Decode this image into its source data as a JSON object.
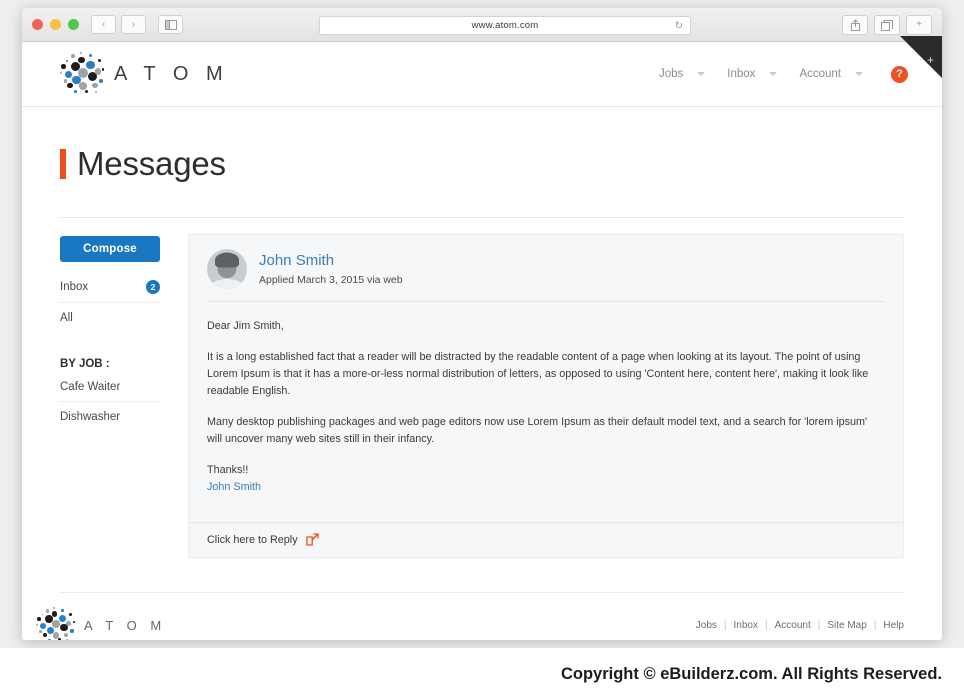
{
  "browser": {
    "url": "www.atom.com",
    "traffic_lights": [
      "close",
      "minimize",
      "maximize"
    ],
    "back_label": "‹",
    "forward_label": "›",
    "sidebar_icon": "sidebar-icon",
    "reload_icon": "reload-icon",
    "share_icon": "share-icon",
    "tabs_icon": "tabs-icon",
    "new_tab_label": "+",
    "corner_plus_label": "+"
  },
  "header": {
    "brand": "A T O M",
    "nav": [
      {
        "label": "Jobs",
        "has_caret": true
      },
      {
        "label": "Inbox",
        "has_caret": true
      },
      {
        "label": "Account",
        "has_caret": true
      }
    ],
    "help_label": "?",
    "help_color": "#ef5022"
  },
  "page": {
    "title": "Messages",
    "accent_color": "#ef5022"
  },
  "sidebar": {
    "compose_label": "Compose",
    "compose_color": "#1a78c2",
    "links": [
      {
        "label": "Inbox",
        "badge": "2"
      },
      {
        "label": "All",
        "badge": ""
      }
    ],
    "by_job_heading": "BY JOB :",
    "jobs": [
      {
        "label": "Cafe Waiter"
      },
      {
        "label": "Dishwasher"
      }
    ]
  },
  "message": {
    "sender": "John Smith",
    "meta": "Applied March 3,  2015 via web",
    "avatar": "user-avatar",
    "greeting": "Dear Jim Smith,",
    "paragraph1": "It is a long established fact that a reader will be distracted by the readable content of a page when looking at its layout. The point of using Lorem Ipsum is that it has a more-or-less normal distribution of letters, as opposed to using 'Content here, content here', making it look like readable English.",
    "paragraph2": "Many desktop publishing packages and web page editors now use Lorem Ipsum as their default model text, and a search for 'lorem ipsum' will uncover many web sites still in their infancy.",
    "closing": "Thanks!!",
    "signature": "John Smith",
    "reply_label": "Click here to Reply",
    "reply_icon_color": "#ef5022",
    "link_color": "#3a7fb5"
  },
  "footer": {
    "brand": "A T O M",
    "links": [
      "Jobs",
      "Inbox",
      "Account",
      "Site Map",
      "Help"
    ],
    "separator": "|"
  },
  "copyright": {
    "text": "Copyright © eBuilderz.com. All Rights Reserved."
  }
}
